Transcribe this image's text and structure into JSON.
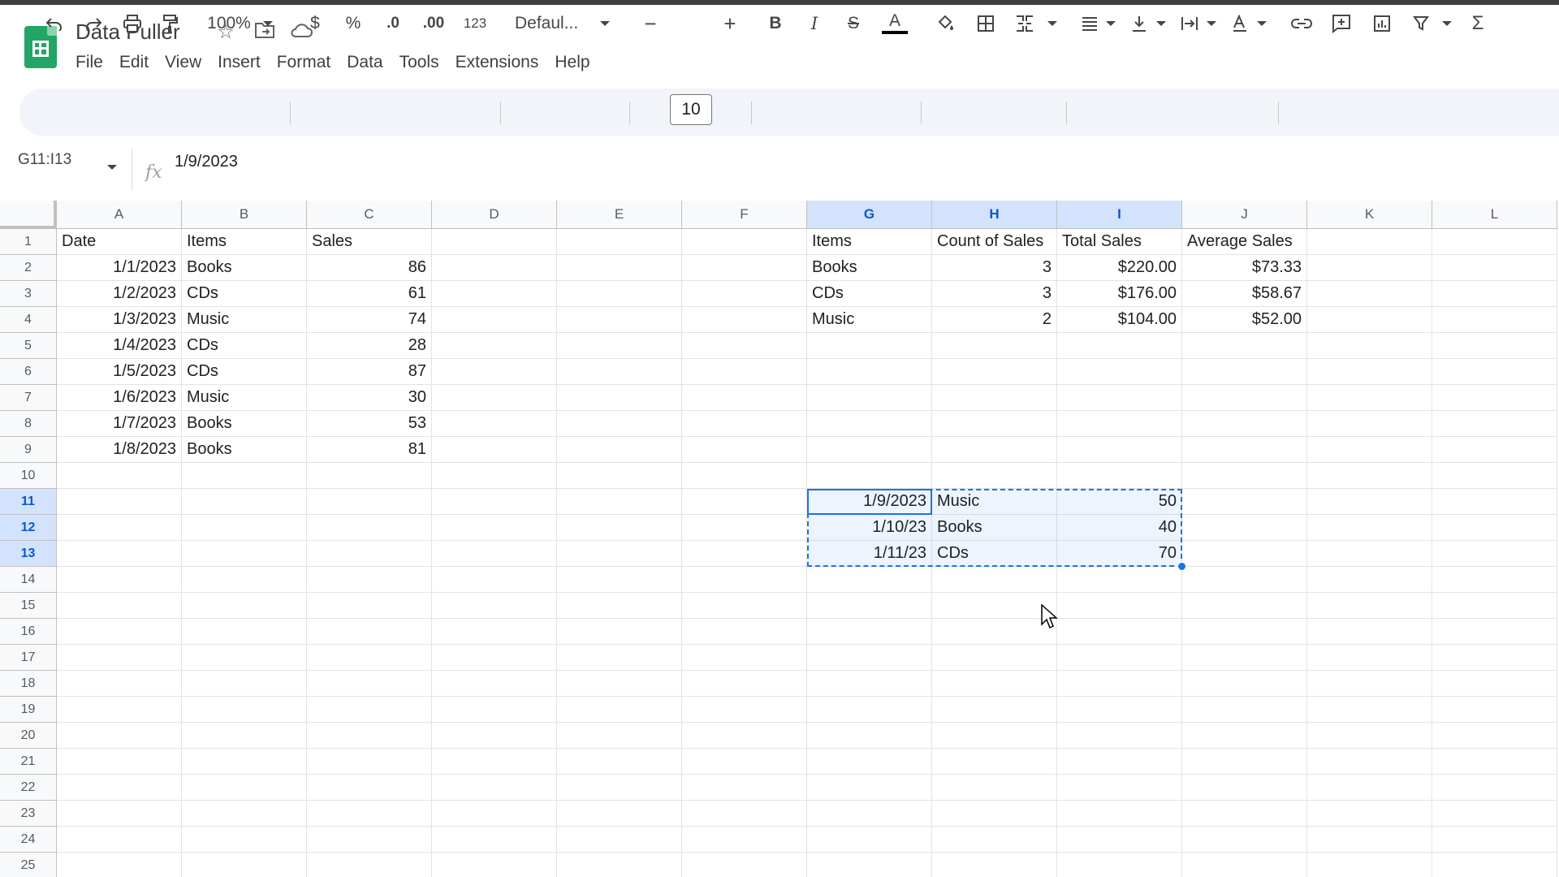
{
  "app": {
    "name": "Google Sheets"
  },
  "document": {
    "title": "Data Puller",
    "title_icons": [
      "star-icon",
      "move-to-folder-icon",
      "cloud-saved-icon"
    ]
  },
  "menu": [
    "File",
    "Edit",
    "View",
    "Insert",
    "Format",
    "Data",
    "Tools",
    "Extensions",
    "Help"
  ],
  "toolbar": {
    "zoom": "100%",
    "currency": "$",
    "percent": "%",
    "decrease_decimal": ".0",
    "increase_decimal": ".00",
    "more_formats": "123",
    "font": "Defaul...",
    "font_size": "10",
    "minus": "−",
    "plus": "+",
    "bold": "B",
    "italic": "I",
    "strikethrough": "S",
    "text_color": "A",
    "sum": "Σ",
    "colors": {
      "text_underline": "#000000",
      "fill": "#444746"
    }
  },
  "formula_bar": {
    "name_box": "G11:I13",
    "fx": "fx",
    "value": "1/9/2023"
  },
  "grid": {
    "columns": [
      "A",
      "B",
      "C",
      "D",
      "E",
      "F",
      "G",
      "H",
      "I",
      "J",
      "K",
      "L"
    ],
    "selected_columns": [
      "G",
      "H",
      "I"
    ],
    "rows": [
      "1",
      "2",
      "3",
      "4",
      "5",
      "6",
      "7",
      "8",
      "9",
      "10",
      "11",
      "12",
      "13",
      "14",
      "15",
      "16",
      "17",
      "18",
      "19",
      "20",
      "21",
      "22",
      "23",
      "24",
      "25"
    ],
    "selected_rows": [
      "11",
      "12",
      "13"
    ],
    "source_table": {
      "headers": [
        "Date",
        "Items",
        "Sales"
      ],
      "rows": [
        [
          "1/1/2023",
          "Books",
          "86"
        ],
        [
          "1/2/2023",
          "CDs",
          "61"
        ],
        [
          "1/3/2023",
          "Music",
          "74"
        ],
        [
          "1/4/2023",
          "CDs",
          "28"
        ],
        [
          "1/5/2023",
          "CDs",
          "87"
        ],
        [
          "1/6/2023",
          "Music",
          "30"
        ],
        [
          "1/7/2023",
          "Books",
          "53"
        ],
        [
          "1/8/2023",
          "Books",
          "81"
        ]
      ]
    },
    "summary_table": {
      "headers": [
        "Items",
        "Count of Sales",
        "Total Sales",
        "Average Sales"
      ],
      "rows": [
        [
          "Books",
          "3",
          "$220.00",
          "$73.33"
        ],
        [
          "CDs",
          "3",
          "$176.00",
          "$58.67"
        ],
        [
          "Music",
          "2",
          "$104.00",
          "$52.00"
        ]
      ]
    },
    "selected_block": {
      "range": "G11:I13",
      "rows": [
        [
          "1/9/2023",
          "Music",
          "50"
        ],
        [
          "1/10/23",
          "Books",
          "40"
        ],
        [
          "1/11/23",
          "CDs",
          "70"
        ]
      ]
    },
    "colors": {
      "selection": "#1a73e8",
      "header_selected": "#d3e3fd"
    }
  }
}
